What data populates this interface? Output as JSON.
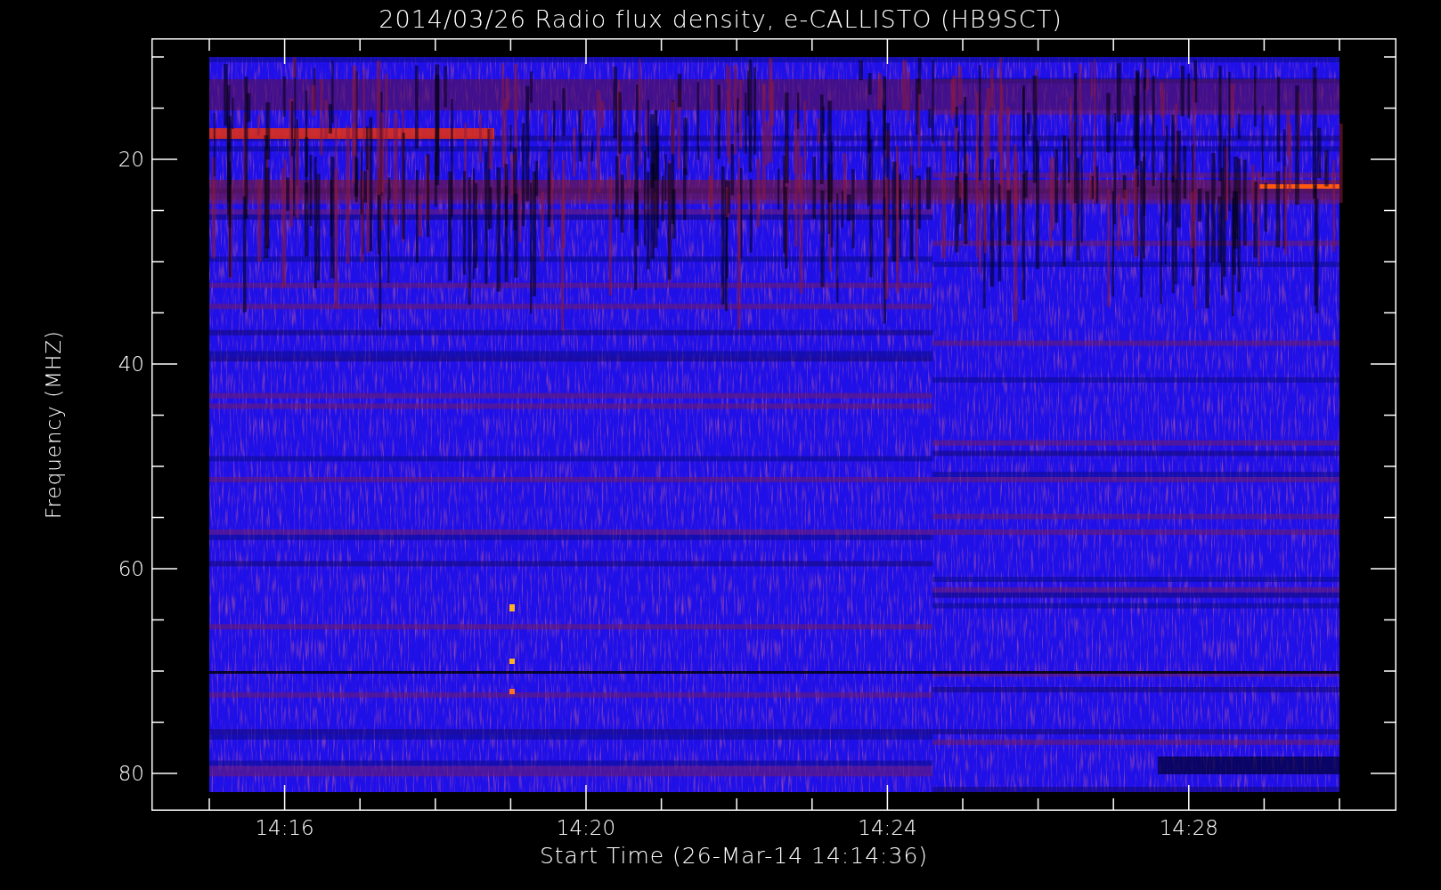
{
  "title": "2014/03/26  Radio flux density, e-CALLISTO (HB9SCT)",
  "plot": {
    "ylabel": "Frequency (MHZ)",
    "xlabel": "Start Time (26-Mar-14 14:14:36)",
    "yticks": [
      "20",
      "40",
      "60",
      "80"
    ],
    "xticks": [
      "14:16",
      "14:20",
      "14:24",
      "14:28"
    ]
  }
}
